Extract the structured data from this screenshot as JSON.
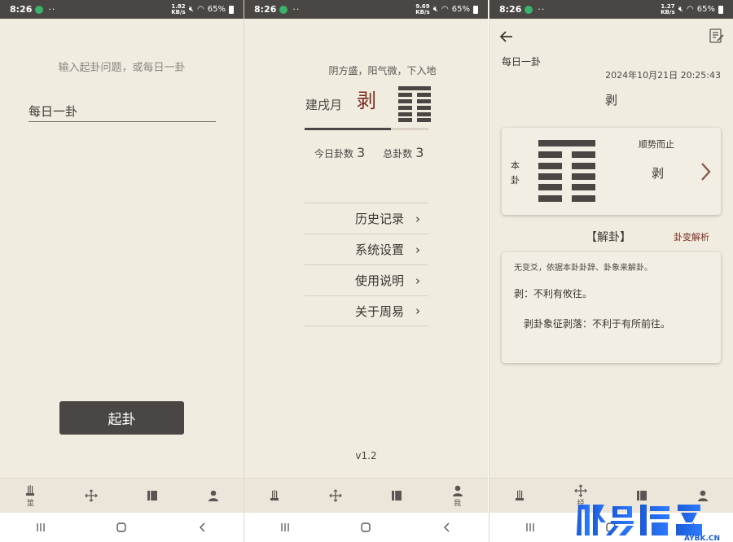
{
  "status": {
    "time": "8:26",
    "battery": "65%",
    "netspeed_screens": [
      [
        "1.82",
        "KB/s"
      ],
      [
        "9.69",
        "KB/s"
      ],
      [
        "1.27",
        "KB/s"
      ]
    ]
  },
  "screen1": {
    "prompt": "输入起卦问题，或每日一卦",
    "input_value": "每日一卦",
    "button_label": "起卦"
  },
  "screen2": {
    "phrase": "阴方盛，阳气微，下入地",
    "month": "建戌月",
    "gua": "剥",
    "progress_fraction": 0.7,
    "today_label": "今日卦数",
    "today_count": "3",
    "total_label": "总卦数",
    "total_count": "3",
    "menu": [
      "历史记录",
      "系统设置",
      "使用说明",
      "关于周易"
    ],
    "version": "v1.2"
  },
  "screen3": {
    "question": "每日一卦",
    "datetime": "2024年10月21日 20:25:43",
    "title": "剥",
    "card_label": "本卦",
    "card_phrase": "顺势而止",
    "card_gua": "剥",
    "jiegua": "【解卦】",
    "bianjie": "卦变解析",
    "panel_line1": "无变爻，依据本卦卦辞、卦象来解卦。",
    "panel_line2": "剥：不利有攸往。",
    "panel_line3": "剥卦象征剥落：不利于有所前往。"
  },
  "nav": {
    "screen1_active_label": "筮",
    "screen2_active_label": "我",
    "screen3_active_label": "经"
  },
  "icons": {
    "nav": [
      "incense-icon",
      "compass-icon",
      "book-icon",
      "person-icon"
    ],
    "sysnav": [
      "recents-icon",
      "home-icon",
      "back-icon"
    ]
  },
  "colors": {
    "background": "#f1ece0",
    "dark": "#4a4643",
    "accent": "#7b2b1e"
  }
}
